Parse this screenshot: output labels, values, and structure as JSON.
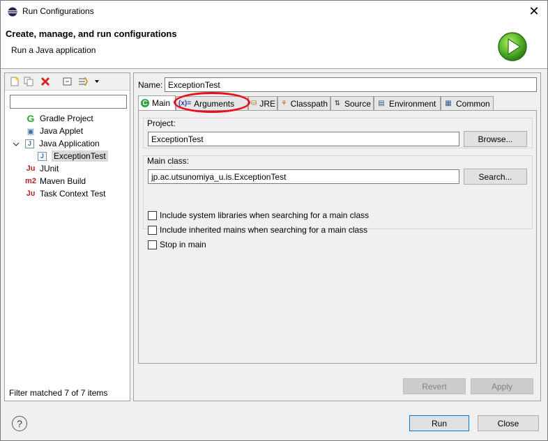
{
  "window": {
    "title": "Run Configurations",
    "close_glyph": "✕"
  },
  "header": {
    "title": "Create, manage, and run configurations",
    "subtitle": "Run a Java application"
  },
  "left": {
    "filter_value": "",
    "tree": [
      {
        "label": "Gradle Project",
        "icon": "gradle-icon",
        "glyph": "G",
        "color": "#2aa533"
      },
      {
        "label": "Java Applet",
        "icon": "java-applet-icon",
        "glyph": "▣",
        "color": "#3a6ea5"
      },
      {
        "label": "Java Application",
        "icon": "java-application-icon",
        "glyph": "J",
        "color": "#3a6ea5"
      },
      {
        "label": "ExceptionTest",
        "icon": "java-file-icon",
        "glyph": "J",
        "color": "#3a6ea5"
      },
      {
        "label": "JUnit",
        "icon": "junit-icon",
        "glyph": "Ju",
        "color": "#b3261e"
      },
      {
        "label": "Maven Build",
        "icon": "maven-icon",
        "glyph": "m2",
        "color": "#b3261e"
      },
      {
        "label": "Task Context Test",
        "icon": "task-context-test-icon",
        "glyph": "Jυ",
        "color": "#b3261e"
      }
    ],
    "status": "Filter matched 7 of 7 items"
  },
  "config": {
    "name_label": "Name:",
    "name_value": "ExceptionTest",
    "tabs": [
      {
        "label": "Main",
        "glyph": "C"
      },
      {
        "label": "Arguments",
        "glyph": "(x)="
      },
      {
        "label": "JRE",
        "glyph": "⛁"
      },
      {
        "label": "Classpath",
        "glyph": "⚘"
      },
      {
        "label": "Source",
        "glyph": "⇅"
      },
      {
        "label": "Environment",
        "glyph": "▤"
      },
      {
        "label": "Common",
        "glyph": "▦"
      }
    ],
    "project_label": "Project:",
    "project_value": "ExceptionTest",
    "browse_label": "Browse...",
    "main_class_label": "Main class:",
    "main_class_value": "jp.ac.utsunomiya_u.is.ExceptionTest",
    "search_label": "Search...",
    "checks": [
      {
        "label": "Include system libraries when searching for a main class",
        "checked": false
      },
      {
        "label": "Include inherited mains when searching for a main class",
        "checked": false
      },
      {
        "label": "Stop in main",
        "checked": false
      }
    ],
    "revert_label": "Revert",
    "apply_label": "Apply"
  },
  "footer": {
    "help_glyph": "?",
    "run_label": "Run",
    "close_label": "Close"
  },
  "colors": {
    "highlight": "#e5121e",
    "accent": "#0078d7"
  }
}
